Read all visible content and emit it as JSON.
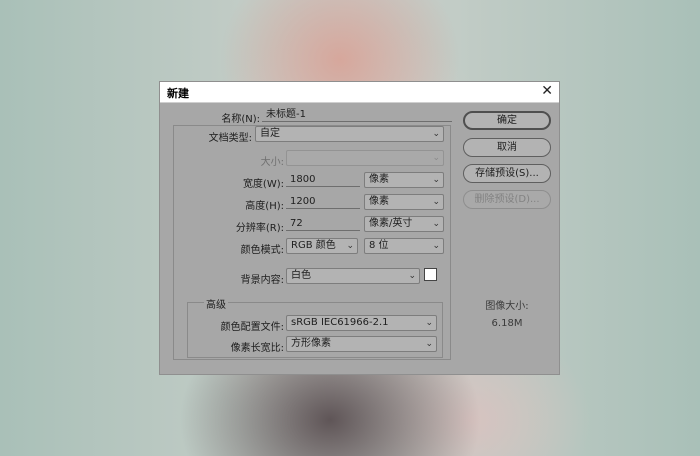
{
  "dialog": {
    "title": "新建",
    "name_label": "名称(N):",
    "name_value": "未标题-1",
    "doc_type_label": "文档类型:",
    "doc_type_value": "自定",
    "size_label": "大小:",
    "size_value": "",
    "width_label": "宽度(W):",
    "width_value": "1800",
    "width_unit": "像素",
    "height_label": "高度(H):",
    "height_value": "1200",
    "height_unit": "像素",
    "resolution_label": "分辨率(R):",
    "resolution_value": "72",
    "resolution_unit": "像素/英寸",
    "color_mode_label": "颜色模式:",
    "color_mode_value": "RGB 颜色",
    "bit_depth_value": "8 位",
    "background_label": "背景内容:",
    "background_value": "白色",
    "advanced_label": "高级",
    "color_profile_label": "颜色配置文件:",
    "color_profile_value": "sRGB IEC61966-2.1",
    "pixel_aspect_label": "像素长宽比:",
    "pixel_aspect_value": "方形像素"
  },
  "buttons": {
    "ok": "确定",
    "cancel": "取消",
    "save_preset": "存储预设(S)...",
    "delete_preset": "删除预设(D)..."
  },
  "image_size": {
    "label": "图像大小:",
    "value": "6.18M"
  },
  "icons": {
    "close": "close-icon",
    "dropdown": "chevron-down-icon"
  },
  "colors": {
    "dialog_bg": "#a7a7a7",
    "swatch": "#ffffff"
  }
}
